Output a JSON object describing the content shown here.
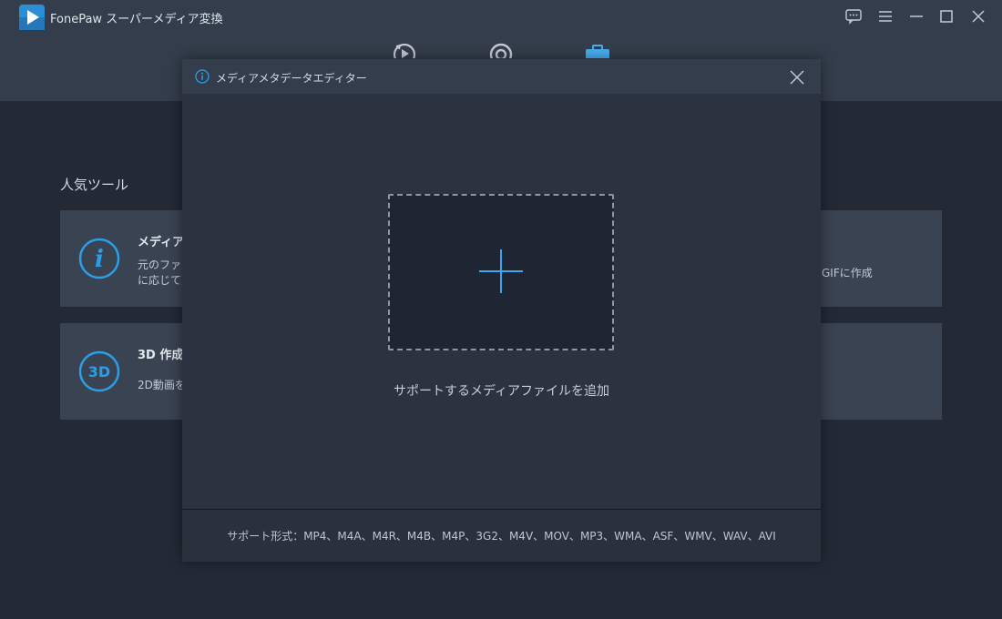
{
  "app": {
    "title": "FonePaw スーパーメディア変換"
  },
  "window_controls": [
    "feedback-icon",
    "menu-icon",
    "minimize-icon",
    "maximize-icon",
    "close-icon"
  ],
  "nav_icons": [
    "converter-icon",
    "toolbox-record-icon",
    "toolbox-icon"
  ],
  "background": {
    "section_title": "人気ツール",
    "cards": [
      {
        "icon": "info-icon",
        "icon_text": "i",
        "name": "メディアメ",
        "desc_line1": "元のファイ",
        "desc_line2": "に応じて変",
        "right_desc": "GIFに作成"
      },
      {
        "icon": "3d-icon",
        "icon_text": "3D",
        "name": "3D 作成",
        "desc_line1": "2D動画を"
      }
    ]
  },
  "modal": {
    "title": "メディアメタデータエディター",
    "drop_label": "サポートするメディアファイルを追加",
    "formats": "サポート形式：MP4、M4A、M4R、M4B、M4P、3G2、M4V、MOV、MP3、WMA、ASF、WMV、WAV、AVI"
  },
  "colors": {
    "accent": "#2a9fe8",
    "header_bg": "#343d4b",
    "page_bg": "#232a36"
  }
}
